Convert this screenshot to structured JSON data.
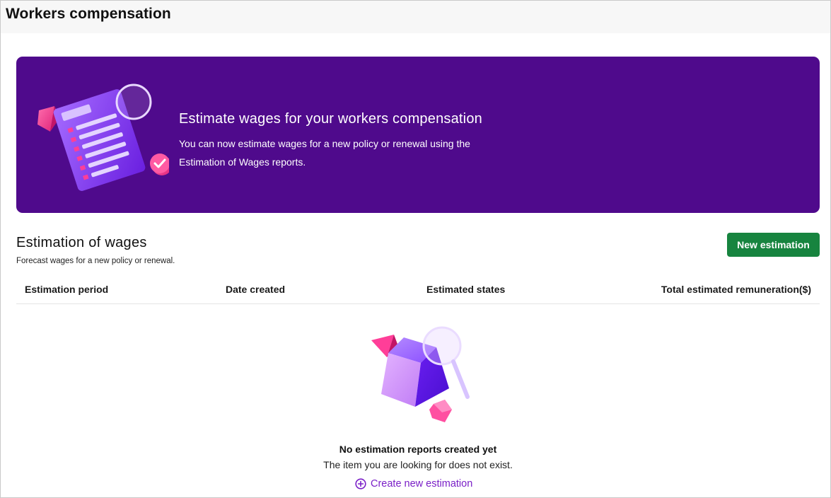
{
  "header": {
    "title": "Workers compensation"
  },
  "hero": {
    "title": "Estimate wages for your workers compensation",
    "description": "You can now estimate wages for a new policy or renewal using the Estimation of Wages reports.",
    "illustration_icon": "checklist-document-icon"
  },
  "section": {
    "title": "Estimation of wages",
    "subtitle": "Forecast wages for a new policy or renewal.",
    "new_button_label": "New estimation"
  },
  "table": {
    "columns": [
      "Estimation period",
      "Date created",
      "Estimated states",
      "Total estimated remuneration($)"
    ]
  },
  "empty_state": {
    "illustration_icon": "cube-magnifier-icon",
    "title": "No estimation reports created yet",
    "description": "The item you are looking for does not exist.",
    "action_label": "Create new estimation",
    "action_icon": "plus-circle-icon"
  },
  "colors": {
    "hero_bg": "#4f0a8c",
    "button_bg": "#17843f",
    "link": "#7a1fc7"
  }
}
